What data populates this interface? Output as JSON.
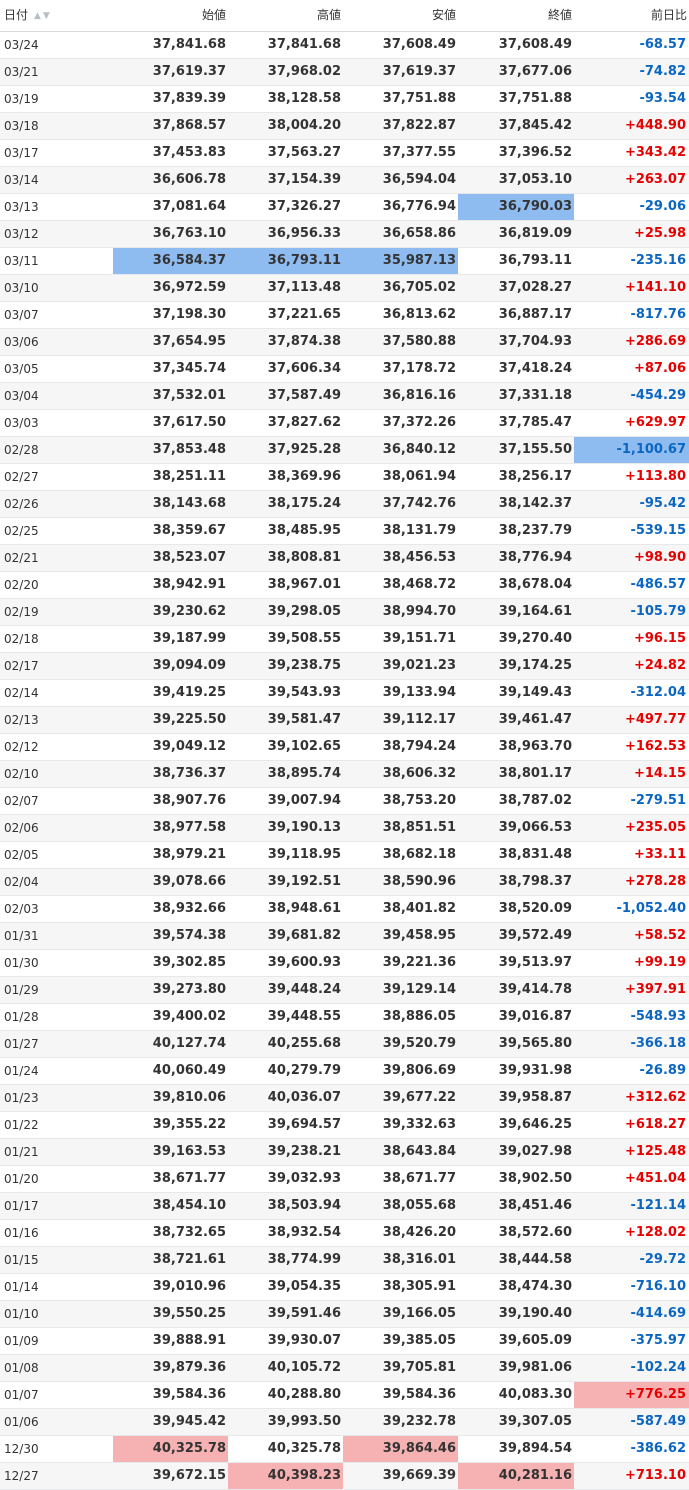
{
  "header": {
    "date": "日付",
    "open": "始値",
    "high": "高値",
    "low": "安値",
    "close": "終値",
    "change": "前日比",
    "sort_icons": "▲▼"
  },
  "colors": {
    "positive": "#e60000",
    "negative": "#0b66c2",
    "highlight_low": "#8fbcf0",
    "highlight_high": "#f6b2b2"
  },
  "rows": [
    {
      "date": "03/24",
      "open": "37,841.68",
      "high": "37,841.68",
      "low": "37,608.49",
      "close": "37,608.49",
      "change": "-68.57"
    },
    {
      "date": "03/21",
      "open": "37,619.37",
      "high": "37,968.02",
      "low": "37,619.37",
      "close": "37,677.06",
      "change": "-74.82"
    },
    {
      "date": "03/19",
      "open": "37,839.39",
      "high": "38,128.58",
      "low": "37,751.88",
      "close": "37,751.88",
      "change": "-93.54"
    },
    {
      "date": "03/18",
      "open": "37,868.57",
      "high": "38,004.20",
      "low": "37,822.87",
      "close": "37,845.42",
      "change": "+448.90"
    },
    {
      "date": "03/17",
      "open": "37,453.83",
      "high": "37,563.27",
      "low": "37,377.55",
      "close": "37,396.52",
      "change": "+343.42"
    },
    {
      "date": "03/14",
      "open": "36,606.78",
      "high": "37,154.39",
      "low": "36,594.04",
      "close": "37,053.10",
      "change": "+263.07"
    },
    {
      "date": "03/13",
      "open": "37,081.64",
      "high": "37,326.27",
      "low": "36,776.94",
      "close": "36,790.03",
      "change": "-29.06",
      "hl": {
        "close": "blue"
      }
    },
    {
      "date": "03/12",
      "open": "36,763.10",
      "high": "36,956.33",
      "low": "36,658.86",
      "close": "36,819.09",
      "change": "+25.98"
    },
    {
      "date": "03/11",
      "open": "36,584.37",
      "high": "36,793.11",
      "low": "35,987.13",
      "close": "36,793.11",
      "change": "-235.16",
      "hl": {
        "open": "blue",
        "high": "blue",
        "low": "blue"
      }
    },
    {
      "date": "03/10",
      "open": "36,972.59",
      "high": "37,113.48",
      "low": "36,705.02",
      "close": "37,028.27",
      "change": "+141.10"
    },
    {
      "date": "03/07",
      "open": "37,198.30",
      "high": "37,221.65",
      "low": "36,813.62",
      "close": "36,887.17",
      "change": "-817.76"
    },
    {
      "date": "03/06",
      "open": "37,654.95",
      "high": "37,874.38",
      "low": "37,580.88",
      "close": "37,704.93",
      "change": "+286.69"
    },
    {
      "date": "03/05",
      "open": "37,345.74",
      "high": "37,606.34",
      "low": "37,178.72",
      "close": "37,418.24",
      "change": "+87.06"
    },
    {
      "date": "03/04",
      "open": "37,532.01",
      "high": "37,587.49",
      "low": "36,816.16",
      "close": "37,331.18",
      "change": "-454.29"
    },
    {
      "date": "03/03",
      "open": "37,617.50",
      "high": "37,827.62",
      "low": "37,372.26",
      "close": "37,785.47",
      "change": "+629.97"
    },
    {
      "date": "02/28",
      "open": "37,853.48",
      "high": "37,925.28",
      "low": "36,840.12",
      "close": "37,155.50",
      "change": "-1,100.67",
      "hl": {
        "change": "blue"
      }
    },
    {
      "date": "02/27",
      "open": "38,251.11",
      "high": "38,369.96",
      "low": "38,061.94",
      "close": "38,256.17",
      "change": "+113.80"
    },
    {
      "date": "02/26",
      "open": "38,143.68",
      "high": "38,175.24",
      "low": "37,742.76",
      "close": "38,142.37",
      "change": "-95.42"
    },
    {
      "date": "02/25",
      "open": "38,359.67",
      "high": "38,485.95",
      "low": "38,131.79",
      "close": "38,237.79",
      "change": "-539.15"
    },
    {
      "date": "02/21",
      "open": "38,523.07",
      "high": "38,808.81",
      "low": "38,456.53",
      "close": "38,776.94",
      "change": "+98.90"
    },
    {
      "date": "02/20",
      "open": "38,942.91",
      "high": "38,967.01",
      "low": "38,468.72",
      "close": "38,678.04",
      "change": "-486.57"
    },
    {
      "date": "02/19",
      "open": "39,230.62",
      "high": "39,298.05",
      "low": "38,994.70",
      "close": "39,164.61",
      "change": "-105.79"
    },
    {
      "date": "02/18",
      "open": "39,187.99",
      "high": "39,508.55",
      "low": "39,151.71",
      "close": "39,270.40",
      "change": "+96.15"
    },
    {
      "date": "02/17",
      "open": "39,094.09",
      "high": "39,238.75",
      "low": "39,021.23",
      "close": "39,174.25",
      "change": "+24.82"
    },
    {
      "date": "02/14",
      "open": "39,419.25",
      "high": "39,543.93",
      "low": "39,133.94",
      "close": "39,149.43",
      "change": "-312.04"
    },
    {
      "date": "02/13",
      "open": "39,225.50",
      "high": "39,581.47",
      "low": "39,112.17",
      "close": "39,461.47",
      "change": "+497.77"
    },
    {
      "date": "02/12",
      "open": "39,049.12",
      "high": "39,102.65",
      "low": "38,794.24",
      "close": "38,963.70",
      "change": "+162.53"
    },
    {
      "date": "02/10",
      "open": "38,736.37",
      "high": "38,895.74",
      "low": "38,606.32",
      "close": "38,801.17",
      "change": "+14.15"
    },
    {
      "date": "02/07",
      "open": "38,907.76",
      "high": "39,007.94",
      "low": "38,753.20",
      "close": "38,787.02",
      "change": "-279.51"
    },
    {
      "date": "02/06",
      "open": "38,977.58",
      "high": "39,190.13",
      "low": "38,851.51",
      "close": "39,066.53",
      "change": "+235.05"
    },
    {
      "date": "02/05",
      "open": "38,979.21",
      "high": "39,118.95",
      "low": "38,682.18",
      "close": "38,831.48",
      "change": "+33.11"
    },
    {
      "date": "02/04",
      "open": "39,078.66",
      "high": "39,192.51",
      "low": "38,590.96",
      "close": "38,798.37",
      "change": "+278.28"
    },
    {
      "date": "02/03",
      "open": "38,932.66",
      "high": "38,948.61",
      "low": "38,401.82",
      "close": "38,520.09",
      "change": "-1,052.40"
    },
    {
      "date": "01/31",
      "open": "39,574.38",
      "high": "39,681.82",
      "low": "39,458.95",
      "close": "39,572.49",
      "change": "+58.52"
    },
    {
      "date": "01/30",
      "open": "39,302.85",
      "high": "39,600.93",
      "low": "39,221.36",
      "close": "39,513.97",
      "change": "+99.19"
    },
    {
      "date": "01/29",
      "open": "39,273.80",
      "high": "39,448.24",
      "low": "39,129.14",
      "close": "39,414.78",
      "change": "+397.91"
    },
    {
      "date": "01/28",
      "open": "39,400.02",
      "high": "39,448.55",
      "low": "38,886.05",
      "close": "39,016.87",
      "change": "-548.93"
    },
    {
      "date": "01/27",
      "open": "40,127.74",
      "high": "40,255.68",
      "low": "39,520.79",
      "close": "39,565.80",
      "change": "-366.18"
    },
    {
      "date": "01/24",
      "open": "40,060.49",
      "high": "40,279.79",
      "low": "39,806.69",
      "close": "39,931.98",
      "change": "-26.89"
    },
    {
      "date": "01/23",
      "open": "39,810.06",
      "high": "40,036.07",
      "low": "39,677.22",
      "close": "39,958.87",
      "change": "+312.62"
    },
    {
      "date": "01/22",
      "open": "39,355.22",
      "high": "39,694.57",
      "low": "39,332.63",
      "close": "39,646.25",
      "change": "+618.27"
    },
    {
      "date": "01/21",
      "open": "39,163.53",
      "high": "39,238.21",
      "low": "38,643.84",
      "close": "39,027.98",
      "change": "+125.48"
    },
    {
      "date": "01/20",
      "open": "38,671.77",
      "high": "39,032.93",
      "low": "38,671.77",
      "close": "38,902.50",
      "change": "+451.04"
    },
    {
      "date": "01/17",
      "open": "38,454.10",
      "high": "38,503.94",
      "low": "38,055.68",
      "close": "38,451.46",
      "change": "-121.14"
    },
    {
      "date": "01/16",
      "open": "38,732.65",
      "high": "38,932.54",
      "low": "38,426.20",
      "close": "38,572.60",
      "change": "+128.02"
    },
    {
      "date": "01/15",
      "open": "38,721.61",
      "high": "38,774.99",
      "low": "38,316.01",
      "close": "38,444.58",
      "change": "-29.72"
    },
    {
      "date": "01/14",
      "open": "39,010.96",
      "high": "39,054.35",
      "low": "38,305.91",
      "close": "38,474.30",
      "change": "-716.10"
    },
    {
      "date": "01/10",
      "open": "39,550.25",
      "high": "39,591.46",
      "low": "39,166.05",
      "close": "39,190.40",
      "change": "-414.69"
    },
    {
      "date": "01/09",
      "open": "39,888.91",
      "high": "39,930.07",
      "low": "39,385.05",
      "close": "39,605.09",
      "change": "-375.97"
    },
    {
      "date": "01/08",
      "open": "39,879.36",
      "high": "40,105.72",
      "low": "39,705.81",
      "close": "39,981.06",
      "change": "-102.24"
    },
    {
      "date": "01/07",
      "open": "39,584.36",
      "high": "40,288.80",
      "low": "39,584.36",
      "close": "40,083.30",
      "change": "+776.25",
      "hl": {
        "change": "red"
      }
    },
    {
      "date": "01/06",
      "open": "39,945.42",
      "high": "39,993.50",
      "low": "39,232.78",
      "close": "39,307.05",
      "change": "-587.49"
    },
    {
      "date": "12/30",
      "open": "40,325.78",
      "high": "40,325.78",
      "low": "39,864.46",
      "close": "39,894.54",
      "change": "-386.62",
      "hl": {
        "open": "red",
        "low": "red"
      }
    },
    {
      "date": "12/27",
      "open": "39,672.15",
      "high": "40,398.23",
      "low": "39,669.39",
      "close": "40,281.16",
      "change": "+713.10",
      "hl": {
        "high": "red",
        "close": "red"
      }
    }
  ]
}
